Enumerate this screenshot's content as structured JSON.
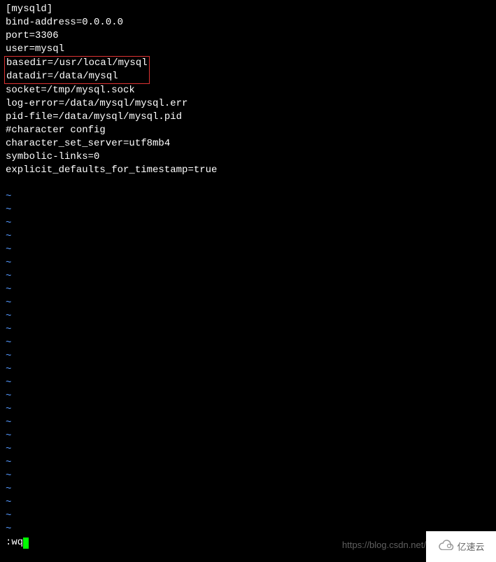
{
  "config": {
    "section_header": "[mysqld]",
    "bind_address": "bind-address=0.0.0.0",
    "port": "port=3306",
    "user": "user=mysql",
    "basedir": "basedir=/usr/local/mysql",
    "datadir": "datadir=/data/mysql",
    "socket": "socket=/tmp/mysql.sock",
    "log_error": "log-error=/data/mysql/mysql.err",
    "pid_file": "pid-file=/data/mysql/mysql.pid",
    "character_comment": "#character config",
    "character_set": "character_set_server=utf8mb4",
    "symbolic_links": "symbolic-links=0",
    "explicit_defaults": "explicit_defaults_for_timestamp=true"
  },
  "tilde_char": "~",
  "tilde_count": 26,
  "command": ":wq",
  "watermark": "https://blog.csdn.net/",
  "logo_text": "亿速云"
}
